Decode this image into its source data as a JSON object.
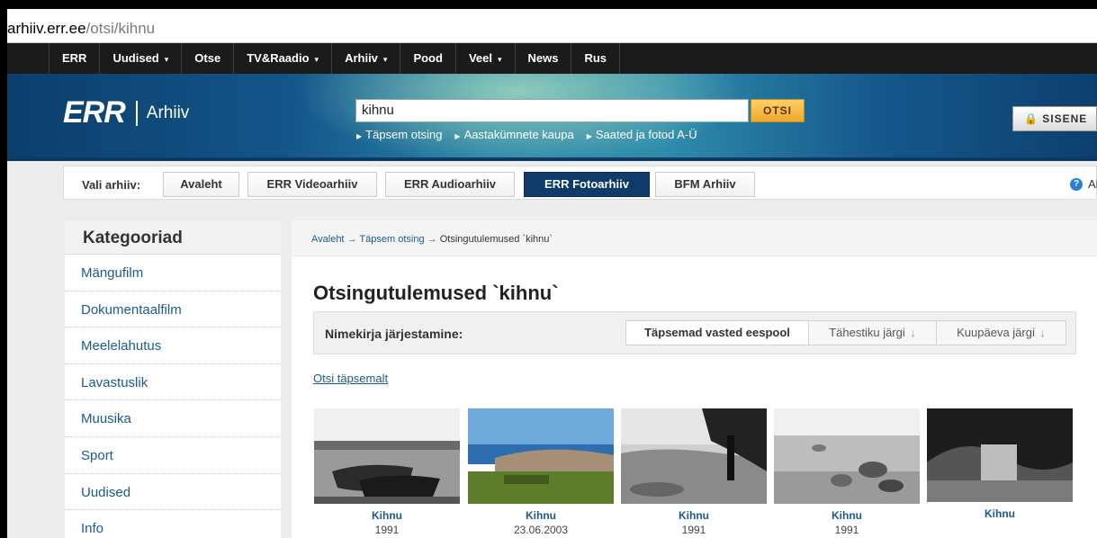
{
  "url": {
    "host": "arhiiv.err.ee",
    "path": "/otsi/kihnu"
  },
  "topnav": [
    {
      "label": "ERR",
      "caret": false
    },
    {
      "label": "Uudised",
      "caret": true
    },
    {
      "label": "Otse",
      "caret": false
    },
    {
      "label": "TV&Raadio",
      "caret": true
    },
    {
      "label": "Arhiiv",
      "caret": true
    },
    {
      "label": "Pood",
      "caret": false
    },
    {
      "label": "Veel",
      "caret": true
    },
    {
      "label": "News",
      "caret": false
    },
    {
      "label": "Rus",
      "caret": false
    }
  ],
  "header": {
    "logo": "ERR",
    "section": "Arhiiv",
    "search_value": "kihnu",
    "search_button": "OTSI",
    "sublinks": [
      "Täpsem otsing",
      "Aastakümnete kaupa",
      "Saated ja fotod A-Ü"
    ],
    "login": "SISENE"
  },
  "archives": {
    "label": "Vali arhiiv:",
    "items": [
      "Avaleht",
      "ERR Videoarhiiv",
      "ERR Audioarhiiv",
      "ERR Fotoarhiiv",
      "BFM Arhiiv"
    ],
    "active": "ERR Fotoarhiiv",
    "help": "Abi"
  },
  "sidebar": {
    "title": "Kategooriad",
    "items": [
      "Mängufilm",
      "Dokumentaalfilm",
      "Meelelahutus",
      "Lavastuslik",
      "Muusika",
      "Sport",
      "Uudised",
      "Info"
    ]
  },
  "breadcrumb": [
    "Avaleht",
    "Täpsem otsing",
    "Otsingutulemused `kihnu`"
  ],
  "results": {
    "heading": "Otsingutulemused `kihnu`",
    "sort_label": "Nimekirja järjestamine:",
    "sort_options": [
      "Täpsemad vasted eespool",
      "Tähestiku järgi",
      "Kuupäeva järgi"
    ],
    "refine_link": "Otsi täpsemalt",
    "photos": [
      {
        "title": "Kihnu",
        "date": "1991"
      },
      {
        "title": "Kihnu",
        "date": "23.06.2003"
      },
      {
        "title": "Kihnu",
        "date": "1991"
      },
      {
        "title": "Kihnu",
        "date": "1991"
      },
      {
        "title": "Kihnu",
        "date": ""
      }
    ]
  }
}
